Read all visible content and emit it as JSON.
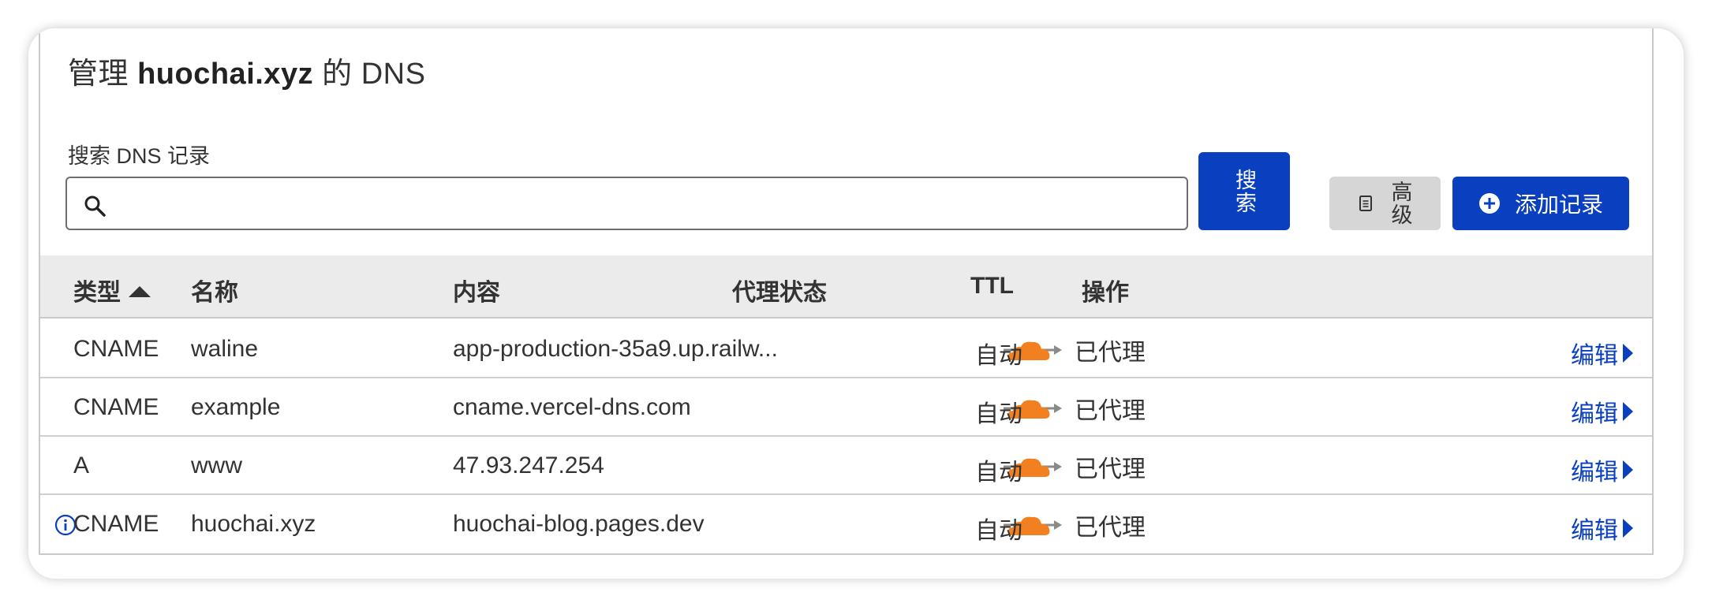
{
  "header": {
    "title_prefix": "管理",
    "domain": "huochai.xyz",
    "title_suffix": "的 DNS"
  },
  "search": {
    "label": "搜索 DNS 记录",
    "value": "",
    "placeholder": "",
    "button_label": "搜索"
  },
  "toolbar": {
    "advanced_label": "高级",
    "add_record_label": "添加记录"
  },
  "table": {
    "columns": [
      "类型",
      "名称",
      "内容",
      "代理状态",
      "TTL",
      "操作"
    ],
    "rows": [
      {
        "type": "CNAME",
        "name": "waline",
        "content": "app-production-35a9.up.railw...",
        "proxy": "已代理",
        "ttl": "自动",
        "action": "编辑",
        "info": false
      },
      {
        "type": "CNAME",
        "name": "example",
        "content": "cname.vercel-dns.com",
        "proxy": "已代理",
        "ttl": "自动",
        "action": "编辑",
        "info": false
      },
      {
        "type": "A",
        "name": "www",
        "content": "47.93.247.254",
        "proxy": "已代理",
        "ttl": "自动",
        "action": "编辑",
        "info": false
      },
      {
        "type": "CNAME",
        "name": "huochai.xyz",
        "content": "huochai-blog.pages.dev",
        "proxy": "已代理",
        "ttl": "自动",
        "action": "编辑",
        "info": true
      }
    ]
  },
  "colors": {
    "primary": "#0a3fbf",
    "cloud": "#f38020",
    "header_bg": "#ebebeb",
    "advanced_bg": "#d6d6d6"
  },
  "icons": {
    "search": "search-icon",
    "advanced": "document-icon",
    "add": "plus-circle-icon",
    "sort": "sort-ascending-icon",
    "proxy": "proxied-cloud-icon",
    "edit": "chevron-right-icon",
    "info": "info-icon"
  }
}
